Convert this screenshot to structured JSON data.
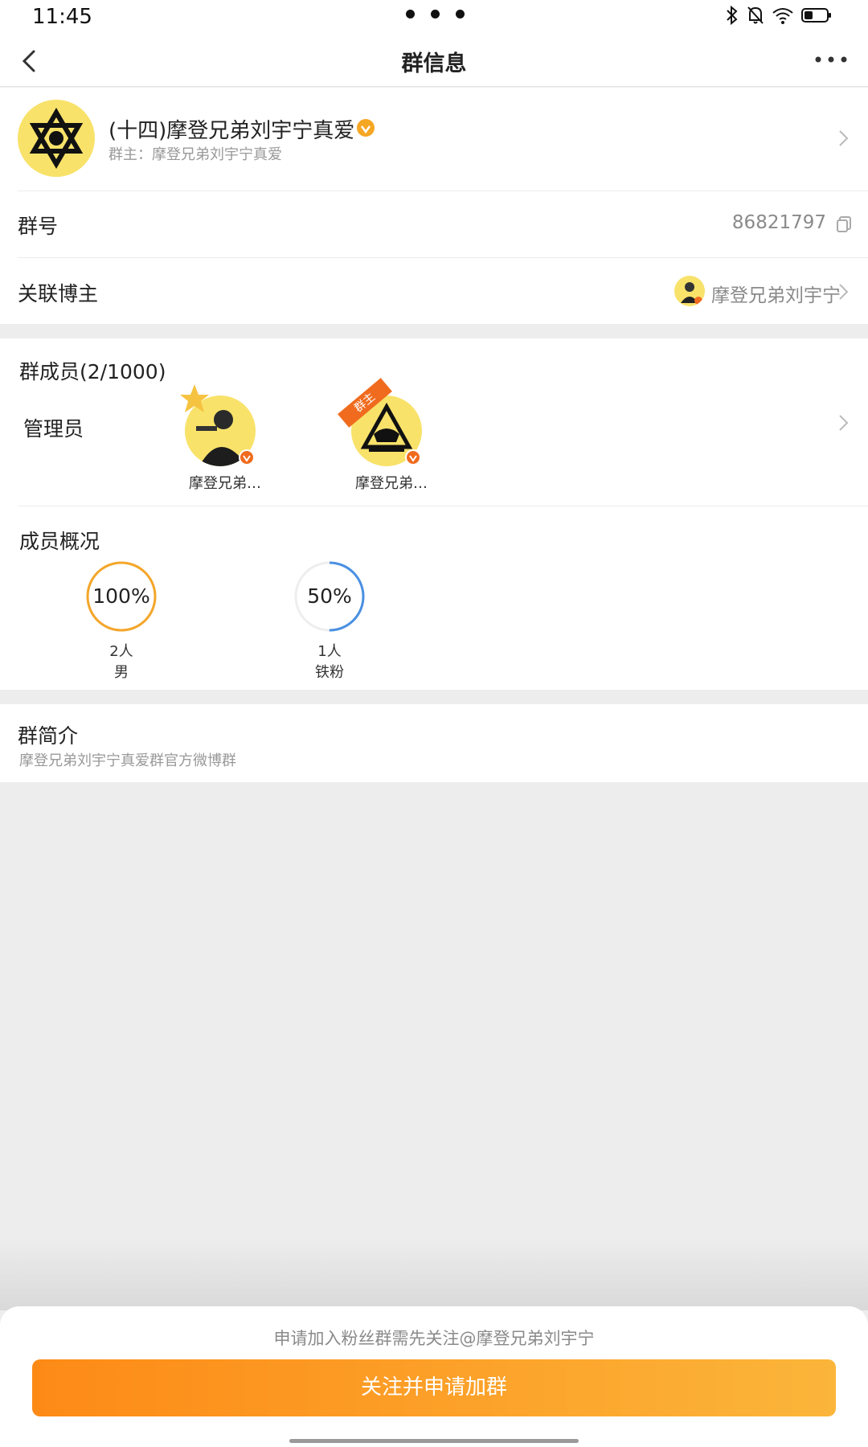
{
  "status": {
    "time": "11:45"
  },
  "nav": {
    "title": "群信息"
  },
  "group": {
    "name": "(十四)摩登兄弟刘宇宁真爱",
    "owner": "群主：摩登兄弟刘宇宁真爱"
  },
  "group_number": {
    "label": "群号",
    "value": "86821797"
  },
  "linked_blogger": {
    "label": "关联博主",
    "name": "摩登兄弟刘宇宁"
  },
  "members": {
    "title": "群成员(2/1000)",
    "admin_label": "管理员",
    "list": [
      {
        "name": "摩登兄弟…"
      },
      {
        "name": "摩登兄弟…",
        "badge": "群主"
      }
    ]
  },
  "overview": {
    "title": "成员概况",
    "stats": [
      {
        "percent": "100%",
        "count": "2人",
        "label": "男",
        "fraction": 1.0,
        "color": "#f4a62a"
      },
      {
        "percent": "50%",
        "count": "1人",
        "label": "铁粉",
        "fraction": 0.5,
        "color": "#4a90e2"
      }
    ]
  },
  "intro": {
    "title": "群简介",
    "text": "摩登兄弟刘宇宁真爱群官方微博群"
  },
  "footer": {
    "tip": "申请加入粉丝群需先关注@摩登兄弟刘宇宁",
    "button": "关注并申请加群"
  },
  "colors": {
    "accent": "#fd8a16",
    "avatar_bg": "#f8e26a",
    "verify": "#f5a623"
  }
}
